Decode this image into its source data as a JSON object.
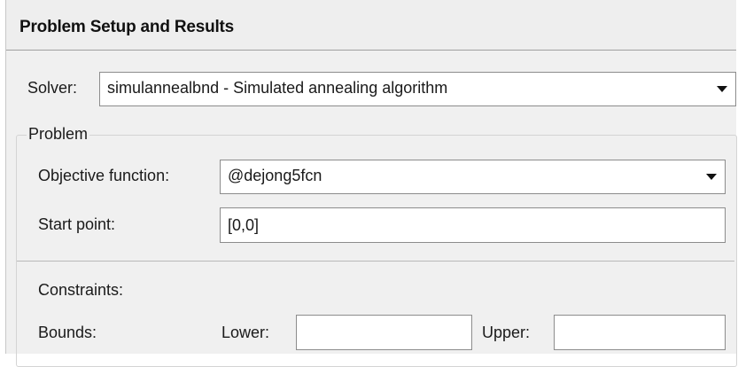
{
  "header": {
    "title": "Problem Setup and Results"
  },
  "solver": {
    "label": "Solver:",
    "selected": "simulannealbnd - Simulated annealing algorithm"
  },
  "problem": {
    "group_title": "Problem",
    "objective_label": "Objective function:",
    "objective_value": "@dejong5fcn",
    "start_label": "Start point:",
    "start_value": "[0,0]"
  },
  "constraints": {
    "label": "Constraints:",
    "bounds_label": "Bounds:",
    "lower_label": "Lower:",
    "lower_value": "",
    "upper_label": "Upper:",
    "upper_value": ""
  }
}
